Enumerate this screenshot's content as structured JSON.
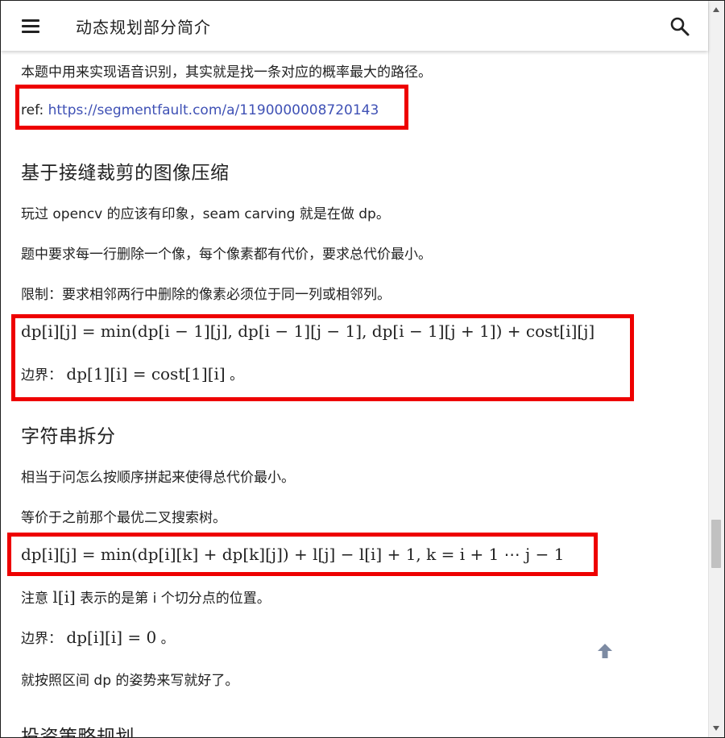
{
  "header": {
    "title": "动态规划部分简介",
    "menu_icon": "hamburger-menu-icon",
    "search_icon": "search-icon"
  },
  "content": {
    "intro_line": "本题中用来实现语音识别，其实就是找一条对应的概率最大的路径。",
    "ref_label": "ref:",
    "ref_link": "https://segmentfault.com/a/1190000008720143",
    "section1": {
      "heading": "基于接缝裁剪的图像压缩",
      "p1": "玩过 opencv 的应该有印象，seam carving 就是在做 dp。",
      "p2": "题中要求每一行删除一个像，每个像素都有代价，要求总代价最小。",
      "p3": "限制：要求相邻两行中删除的像素必须位于同一列或相邻列。",
      "formula": "dp[i][j] = min(dp[i − 1][j], dp[i − 1][j − 1], dp[i − 1][j + 1]) + cost[i][j]",
      "boundary_label": "边界：",
      "boundary_formula": "dp[1][i] = cost[1][i]",
      "boundary_end": "。"
    },
    "section2": {
      "heading": "字符串拆分",
      "p1": "相当于问怎么按顺序拼起来使得总代价最小。",
      "p2": "等价于之前那个最优二叉搜索树。",
      "formula": "dp[i][j] = min(dp[i][k] + dp[k][j]) + l[j] − l[i] + 1,  k = i + 1 ⋯ j − 1",
      "note_prefix": "注意",
      "note_math": "l[i]",
      "note_suffix": "表示的是第 i 个切分点的位置。",
      "boundary_label": "边界：",
      "boundary_formula": "dp[i][i] = 0",
      "boundary_end": "。",
      "p_last": "就按照区间 dp 的姿势来写就好了。"
    },
    "section3": {
      "heading": "投资策略规划"
    }
  },
  "colors": {
    "highlight_box": "#ee0000",
    "link": "#3f51b5",
    "text": "#222222"
  },
  "scroll_to_top_icon": "arrow-up-icon"
}
